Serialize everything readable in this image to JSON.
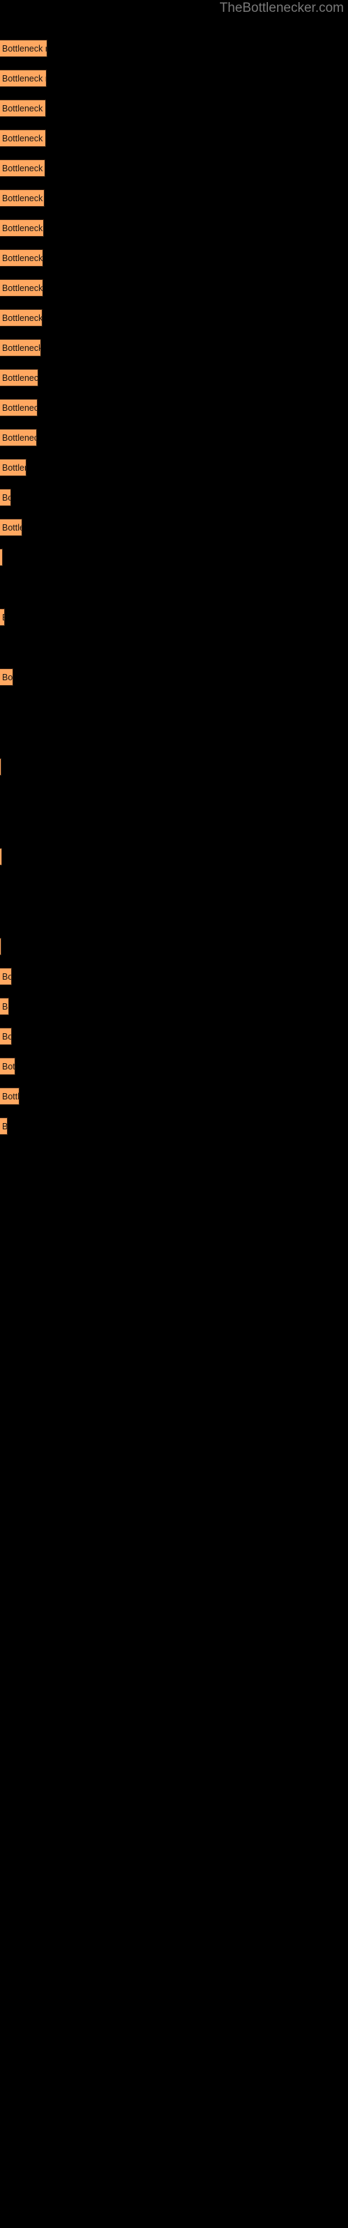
{
  "site": {
    "title": "TheBottlenecker.com"
  },
  "colors": {
    "background": "#000000",
    "bar_fill": "#ffa861",
    "bar_border": "#3a2313",
    "bar_text": "#141414",
    "title_text": "#7a7a7a"
  },
  "chart_data": {
    "type": "bar",
    "orientation": "horizontal",
    "title": "TheBottlenecker.com",
    "xlabel": "",
    "ylabel": "",
    "grid": false,
    "legend": false,
    "bar_label_text": "Bottleneck result",
    "categories": [
      "Bottleneck result",
      "Bottleneck result",
      "Bottleneck result",
      "Bottleneck result",
      "Bottleneck result",
      "Bottleneck result",
      "Bottleneck result",
      "Bottleneck result",
      "Bottleneck result",
      "Bottleneck result",
      "Bottleneck result",
      "Bottleneck result",
      "Bottleneck result",
      "Bottleneck result",
      "Bottleneck result",
      "Bottleneck result",
      "Bottleneck result",
      "Bottleneck result",
      "Bottleneck result",
      "Bottleneck result",
      "Bottleneck result",
      "Bottleneck result",
      "Bottleneck result",
      "Bottleneck result",
      "Bottleneck result",
      "Bottleneck result",
      "Bottleneck result",
      "Bottleneck result",
      "Bottleneck result",
      "Bottleneck result",
      "Bottleneck result",
      "Bottleneck result",
      "Bottleneck result",
      "Bottleneck result",
      "Bottleneck result"
    ],
    "values": [
      80,
      80,
      80,
      80,
      80,
      80,
      80,
      80,
      80,
      80,
      80,
      80,
      80,
      61,
      22,
      54,
      9,
      13,
      33,
      4,
      4,
      3,
      23,
      18,
      23,
      26,
      34,
      13
    ],
    "xlim": [
      0,
      500
    ],
    "bars": [
      {
        "y": 57,
        "height": 25,
        "width": 80,
        "label": "Bottleneck result"
      },
      {
        "y": 100,
        "height": 25,
        "width": 80,
        "label": "Bottleneck result"
      },
      {
        "y": 143,
        "height": 25,
        "width": 80,
        "label": "Bottleneck result"
      },
      {
        "y": 186,
        "height": 25,
        "width": 80,
        "label": "Bottleneck result"
      },
      {
        "y": 229,
        "height": 25,
        "width": 80,
        "label": "Bottleneck result"
      },
      {
        "y": 272,
        "height": 25,
        "width": 79,
        "label": "Bottleneck result"
      },
      {
        "y": 315,
        "height": 25,
        "width": 79,
        "label": "Bottleneck result"
      },
      {
        "y": 358,
        "height": 25,
        "width": 79,
        "label": "Bottleneck result"
      },
      {
        "y": 401,
        "height": 25,
        "width": 78,
        "label": "Bottleneck result"
      },
      {
        "y": 444,
        "height": 25,
        "width": 78,
        "label": "Bottleneck result"
      },
      {
        "y": 487,
        "height": 25,
        "width": 76,
        "label": "Bottleneck result"
      },
      {
        "y": 530,
        "height": 25,
        "width": 74,
        "label": "Bottleneck result"
      },
      {
        "y": 573,
        "height": 25,
        "width": 72,
        "label": "Bottleneck result"
      },
      {
        "y": 616,
        "height": 25,
        "width": 70,
        "label": "Bottleneck result"
      },
      {
        "y": 659,
        "height": 25,
        "width": 68,
        "label": "Bottleneck result"
      },
      {
        "y": 702,
        "height": 25,
        "width": 66,
        "label": "Bottleneck result"
      },
      {
        "y": 745,
        "height": 25,
        "width": 64,
        "label": "Bottleneck result"
      },
      {
        "y": 788,
        "height": 25,
        "width": 62,
        "label": "Bottleneck result"
      },
      {
        "y": 831,
        "height": 25,
        "width": 60,
        "label": "Bottleneck result"
      },
      {
        "y": 874,
        "height": 25,
        "width": 57,
        "label": "Bottleneck result"
      },
      {
        "y": 917,
        "height": 25,
        "width": 55,
        "label": "Bottleneck result"
      },
      {
        "y": 960,
        "height": 25,
        "width": 53,
        "label": "Bottleneck result"
      },
      {
        "y": 1003,
        "height": 25,
        "width": 50,
        "label": "Bottleneck result"
      },
      {
        "y": 1046,
        "height": 25,
        "width": 48,
        "label": "Bottleneck result"
      },
      {
        "y": 1089,
        "height": 25,
        "width": 44,
        "label": "Bottleneck result"
      },
      {
        "y": 1132,
        "height": 25,
        "width": 40,
        "label": "Bottleneck result"
      },
      {
        "y": 1175,
        "height": 25,
        "width": 37,
        "label": "Bottleneck result"
      },
      {
        "y": 1218,
        "height": 25,
        "width": 33,
        "label": "Bottleneck result"
      },
      {
        "y": 1261,
        "height": 25,
        "width": 24,
        "label": "Bottleneck result"
      },
      {
        "y": 1304,
        "height": 25,
        "width": 8,
        "label": "Bottleneck result"
      },
      {
        "y": 1347,
        "height": 25,
        "width": 20,
        "label": "Bottleneck result"
      },
      {
        "y": 1390,
        "height": 25,
        "width": 2,
        "label": "Bottleneck result"
      },
      {
        "y": 1433,
        "height": 25,
        "width": 3,
        "label": "Bottleneck result"
      },
      {
        "y": 1476,
        "height": 25,
        "width": 11,
        "label": "Bottleneck result"
      },
      {
        "y": 1519,
        "height": 25,
        "width": 2,
        "label": "Bottleneck result"
      },
      {
        "y": 1562,
        "height": 25,
        "width": 2,
        "label": "Bottleneck result"
      },
      {
        "y": 1605,
        "height": 25,
        "width": 2,
        "label": "Bottleneck result"
      },
      {
        "y": 1648,
        "height": 25,
        "width": 7,
        "label": "Bottleneck result"
      },
      {
        "y": 1691,
        "height": 25,
        "width": 6,
        "label": "Bottleneck result"
      },
      {
        "y": 1734,
        "height": 25,
        "width": 7,
        "label": "Bottleneck result"
      },
      {
        "y": 1777,
        "height": 25,
        "width": 9,
        "label": "Bottleneck result"
      },
      {
        "y": 1820,
        "height": 25,
        "width": 11,
        "label": "Bottleneck result"
      },
      {
        "y": 1863,
        "height": 25,
        "width": 4,
        "label": "Bottleneck result"
      }
    ]
  },
  "bars": [
    {
      "y": 30,
      "height": 27,
      "width": 68,
      "label": "Bottleneck result"
    },
    {
      "y": 73,
      "height": 27,
      "width": 67,
      "label": "Bottleneck result"
    },
    {
      "y": 116,
      "height": 27,
      "width": 66,
      "label": "Bottleneck result"
    },
    {
      "y": 159,
      "height": 27,
      "width": 66,
      "label": "Bottleneck result"
    },
    {
      "y": 202,
      "height": 27,
      "width": 65,
      "label": "Bottleneck result"
    },
    {
      "y": 245,
      "height": 27,
      "width": 64,
      "label": "Bottleneck result"
    },
    {
      "y": 288,
      "height": 27,
      "width": 63,
      "label": "Bottleneck result"
    },
    {
      "y": 331,
      "height": 27,
      "width": 62,
      "label": "Bottleneck result"
    },
    {
      "y": 374,
      "height": 27,
      "width": 62,
      "label": "Bottleneck result"
    },
    {
      "y": 417,
      "height": 27,
      "width": 61,
      "label": "Bottleneck result"
    },
    {
      "y": 460,
      "height": 27,
      "width": 59,
      "label": "Bottleneck result"
    },
    {
      "y": 503,
      "height": 27,
      "width": 55,
      "label": "Bottleneck result"
    },
    {
      "y": 546,
      "height": 27,
      "width": 54,
      "label": "Bottleneck result"
    },
    {
      "y": 589,
      "height": 27,
      "width": 53,
      "label": "Bottleneck result"
    },
    {
      "y": 632,
      "height": 27,
      "width": 38,
      "label": "Bottleneck result"
    },
    {
      "y": 675,
      "height": 27,
      "width": 16,
      "label": "Bottleneck result"
    },
    {
      "y": 718,
      "height": 27,
      "width": 32,
      "label": "Bottleneck result"
    },
    {
      "y": 761,
      "height": 27,
      "width": 4,
      "label": "Bottleneck result"
    },
    {
      "y": 820,
      "height": 27,
      "width": 7,
      "label": "Bottleneck result"
    },
    {
      "y": 934,
      "height": 27,
      "width": 19,
      "label": "Bottleneck result"
    },
    {
      "y": 1020,
      "height": 27,
      "width": 2,
      "label": "Bottleneck result"
    },
    {
      "y": 1148,
      "height": 27,
      "width": 3,
      "label": "Bottleneck result"
    },
    {
      "y": 1278,
      "height": 27,
      "width": 2,
      "label": "Bottleneck result"
    },
    {
      "y": 1325,
      "height": 27,
      "width": 17,
      "label": "Bottleneck result"
    },
    {
      "y": 1368,
      "height": 27,
      "width": 13,
      "label": "Bottleneck result"
    },
    {
      "y": 1411,
      "height": 27,
      "width": 17,
      "label": "Bottleneck result"
    },
    {
      "y": 1454,
      "height": 27,
      "width": 22,
      "label": "Bottleneck result"
    },
    {
      "y": 1497,
      "height": 27,
      "width": 28,
      "label": "Bottleneck result"
    },
    {
      "y": 1540,
      "height": 27,
      "width": 11,
      "label": "Bottleneck result"
    }
  ]
}
